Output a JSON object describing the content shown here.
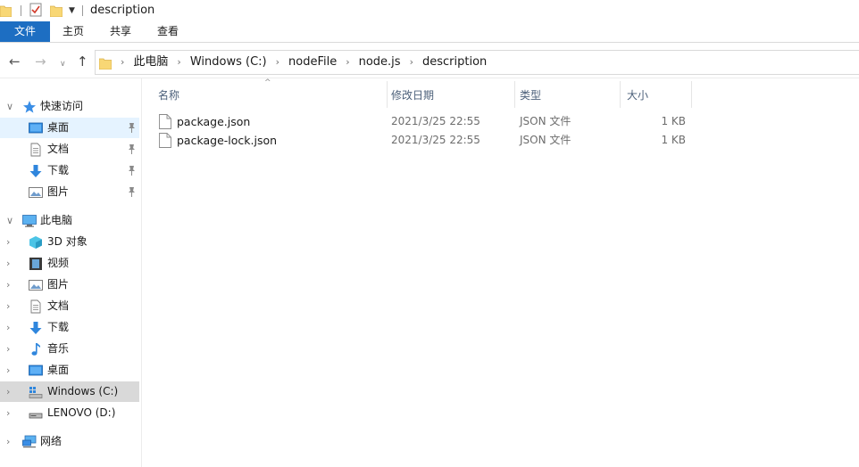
{
  "window": {
    "title": "description"
  },
  "ribbon": {
    "tabs": [
      "文件",
      "主页",
      "共享",
      "查看"
    ]
  },
  "address": {
    "crumbs": [
      "此电脑",
      "Windows (C:)",
      "nodeFile",
      "node.js",
      "description"
    ]
  },
  "sidebar": {
    "quick_access": {
      "label": "快速访问",
      "items": [
        "桌面",
        "文档",
        "下载",
        "图片"
      ]
    },
    "this_pc": {
      "label": "此电脑",
      "items": [
        "3D 对象",
        "视频",
        "图片",
        "文档",
        "下载",
        "音乐",
        "桌面",
        "Windows (C:)",
        "LENOVO (D:)"
      ]
    },
    "network": {
      "label": "网络"
    }
  },
  "columns": {
    "name": "名称",
    "date": "修改日期",
    "type": "类型",
    "size": "大小"
  },
  "files": [
    {
      "name": "package.json",
      "date": "2021/3/25 22:55",
      "type": "JSON 文件",
      "size": "1 KB"
    },
    {
      "name": "package-lock.json",
      "date": "2021/3/25 22:55",
      "type": "JSON 文件",
      "size": "1 KB"
    }
  ],
  "colors": {
    "accent": "#1d6ec2",
    "selected_bg": "#e5f3ff",
    "current_bg": "#d9d9d9"
  }
}
